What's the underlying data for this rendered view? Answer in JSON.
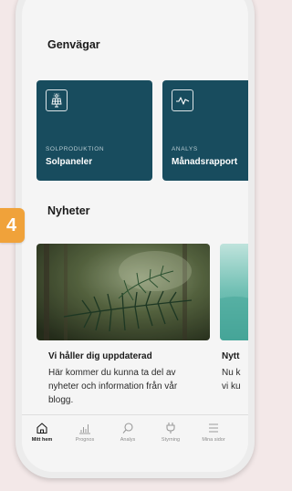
{
  "step_badge": "4",
  "shortcuts": {
    "title": "Genvägar",
    "cards": [
      {
        "category": "SOLPRODUKTION",
        "name": "Solpaneler",
        "icon": "solar-panel-icon"
      },
      {
        "category": "ANALYS",
        "name": "Månadsrapport",
        "icon": "line-chart-icon"
      }
    ]
  },
  "news": {
    "title": "Nyheter",
    "items": [
      {
        "title": "Vi håller dig uppdaterad",
        "lines": [
          "Här kommer du kunna ta del av",
          "nyheter och information från vår",
          "blogg."
        ],
        "image": "fir-branch-photo"
      },
      {
        "title": "Nytt",
        "lines": [
          "Nu k",
          "vi ku"
        ],
        "image": "teal-water-photo"
      }
    ]
  },
  "tabbar": {
    "tabs": [
      {
        "label": "Mitt hem",
        "icon": "home-icon",
        "active": true
      },
      {
        "label": "Prognos",
        "icon": "bar-chart-icon",
        "active": false
      },
      {
        "label": "Analys",
        "icon": "search-icon",
        "active": false
      },
      {
        "label": "Styrning",
        "icon": "plug-icon",
        "active": false
      },
      {
        "label": "Mina sidor",
        "icon": "menu-icon",
        "active": false
      }
    ]
  },
  "colors": {
    "card": "#184c5e",
    "badge": "#f0a23a",
    "background": "#f3e8e8"
  }
}
